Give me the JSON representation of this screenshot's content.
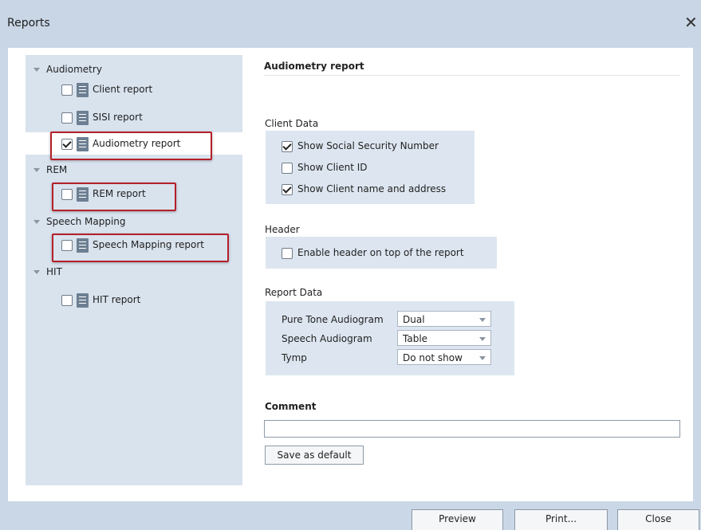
{
  "window": {
    "title": "Reports",
    "close_glyph": "✕"
  },
  "tree": {
    "groups": [
      {
        "label": "Audiometry",
        "items": [
          {
            "label": "Client report",
            "checked": false
          },
          {
            "label": "SISI report",
            "checked": false
          },
          {
            "label": "Audiometry report",
            "checked": true,
            "selected": true
          }
        ]
      },
      {
        "label": "REM",
        "items": [
          {
            "label": "REM report",
            "checked": false
          }
        ]
      },
      {
        "label": "Speech Mapping",
        "items": [
          {
            "label": "Speech Mapping report",
            "checked": false
          }
        ]
      },
      {
        "label": "HIT",
        "items": [
          {
            "label": "HIT report",
            "checked": false
          }
        ]
      }
    ]
  },
  "detail": {
    "heading": "Audiometry report",
    "client_data": {
      "label": "Client Data",
      "options": [
        {
          "label": "Show Social Security Number",
          "checked": true
        },
        {
          "label": "Show Client ID",
          "checked": false
        },
        {
          "label": "Show Client name and address",
          "checked": true
        }
      ]
    },
    "header": {
      "label": "Header",
      "option": {
        "label": "Enable header on top of the report",
        "checked": false
      }
    },
    "report_data": {
      "label": "Report Data",
      "rows": [
        {
          "label": "Pure Tone Audiogram",
          "value": "Dual"
        },
        {
          "label": "Speech Audiogram",
          "value": "Table"
        },
        {
          "label": "Tymp",
          "value": "Do not show"
        }
      ]
    },
    "comment": {
      "label": "Comment",
      "value": ""
    },
    "save_default_label": "Save as default"
  },
  "footer": {
    "preview_label": "Preview",
    "print_label": "Print...",
    "close_label": "Close"
  },
  "colors": {
    "highlight": "#b4202a",
    "tree_bg": "#d9e3ee",
    "titlebar_bg": "#c8d6e5"
  }
}
